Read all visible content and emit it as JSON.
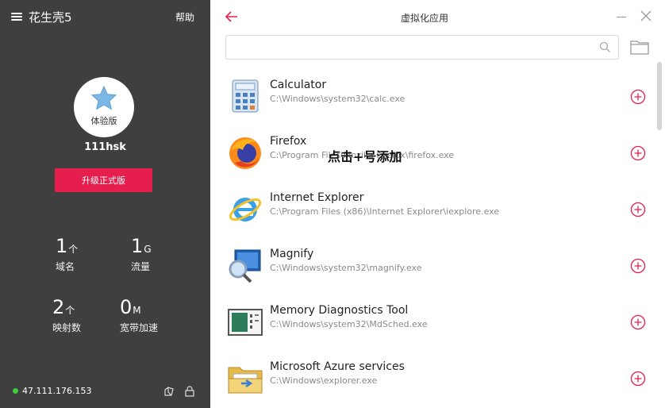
{
  "sidebar": {
    "brand": "花生壳5",
    "help": "帮助",
    "edition": "体验版",
    "username": "111hsk",
    "upgrade_label": "升级正式版",
    "stats": [
      {
        "num": "1",
        "unit": "个",
        "label": "域名"
      },
      {
        "num": "1",
        "unit": "G",
        "label": "流量"
      },
      {
        "num": "2",
        "unit": "个",
        "label": "映射数"
      },
      {
        "num": "0",
        "unit": "M",
        "label": "宽带加速"
      }
    ],
    "ip": "47.111.176.153",
    "accent": "#e61e4d",
    "bg": "#3f3f3f",
    "status_color": "#3bcf3b"
  },
  "header": {
    "title": "虚拟化应用"
  },
  "search": {
    "value": "",
    "placeholder": ""
  },
  "apps": [
    {
      "name": "Calculator",
      "path": "C:\\Windows\\system32\\calc.exe",
      "icon": "calculator-icon"
    },
    {
      "name": "Firefox",
      "path": "C:\\Program Files\\Mozilla Firefox\\firefox.exe",
      "icon": "firefox-icon"
    },
    {
      "name": "Internet Explorer",
      "path": "C:\\Program Files (x86)\\Internet Explorer\\iexplore.exe",
      "icon": "internet-explorer-icon"
    },
    {
      "name": "Magnify",
      "path": "C:\\Windows\\system32\\magnify.exe",
      "icon": "magnify-icon"
    },
    {
      "name": "Memory Diagnostics Tool",
      "path": "C:\\Windows\\system32\\MdSched.exe",
      "icon": "memory-diagnostics-icon"
    },
    {
      "name": "Microsoft Azure services",
      "path": "C:\\Windows\\explorer.exe",
      "icon": "folder-app-icon"
    }
  ],
  "annotation": "点击+号添加"
}
